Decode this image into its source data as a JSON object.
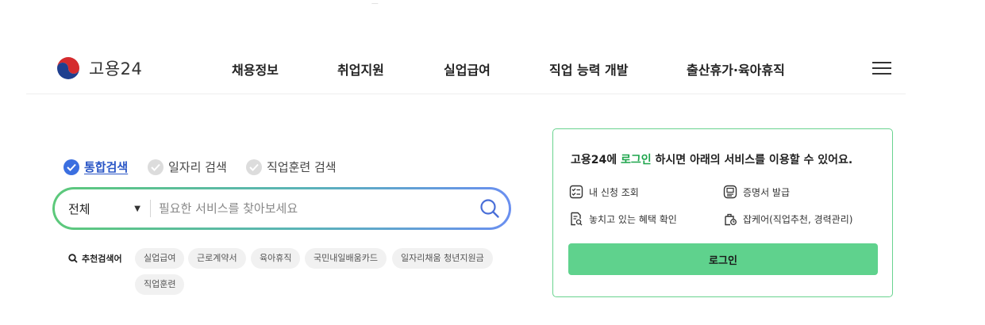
{
  "header": {
    "logo_text": "고용24",
    "nav": [
      "채용정보",
      "취업지원",
      "실업급여",
      "직업 능력 개발",
      "출산휴가·육아휴직"
    ]
  },
  "search": {
    "tabs": [
      {
        "label": "통합검색",
        "active": true
      },
      {
        "label": "일자리 검색",
        "active": false
      },
      {
        "label": "직업훈련 검색",
        "active": false
      }
    ],
    "category_selected": "전체",
    "placeholder": "필요한 서비스를 찾아보세요",
    "recommended_label": "추천검색어",
    "recommended": [
      "실업급여",
      "근로계약서",
      "육아휴직",
      "국민내일배움카드",
      "일자리채움 청년지원금",
      "직업훈련"
    ]
  },
  "login_panel": {
    "msg_pre": "고용24에 ",
    "msg_highlight": "로그인",
    "msg_post": " 하시면 아래의 서비스를 이용할 수 있어요.",
    "services": [
      "내 신청 조회",
      "증명서 발급",
      "놓치고 있는 혜택 확인",
      "잡케어(직업추천, 경력관리)"
    ],
    "login_button": "로그인"
  },
  "colors": {
    "accent_blue": "#3b6fe0",
    "accent_green": "#5fd28d",
    "highlight_green": "#1ea54c"
  }
}
